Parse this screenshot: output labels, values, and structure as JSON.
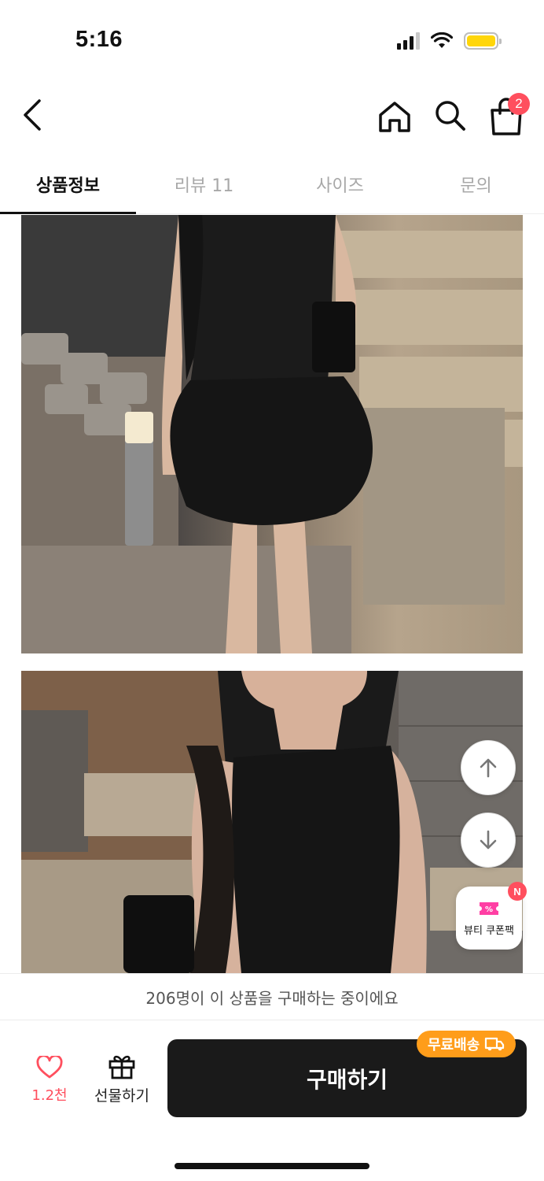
{
  "status_bar": {
    "time": "5:16"
  },
  "top_nav": {
    "cart_count": "2"
  },
  "tabs": [
    {
      "label": "상품정보",
      "active": true
    },
    {
      "label": "리뷰 11",
      "active": false
    },
    {
      "label": "사이즈",
      "active": false
    },
    {
      "label": "문의",
      "active": false
    }
  ],
  "floating": {
    "coupon_label": "뷰티 쿠폰팩",
    "coupon_badge": "N"
  },
  "notice": {
    "text": "206명이 이 상품을 구매하는 중이에요"
  },
  "bottom_bar": {
    "like_count": "1.2천",
    "gift_label": "선물하기",
    "buy_label": "구매하기",
    "free_shipping_label": "무료배송"
  },
  "colors": {
    "accent_red": "#ff4f5e",
    "buy_button": "#1a1a1a",
    "free_shipping": "#ff9d1a",
    "battery": "#ffd60a"
  }
}
